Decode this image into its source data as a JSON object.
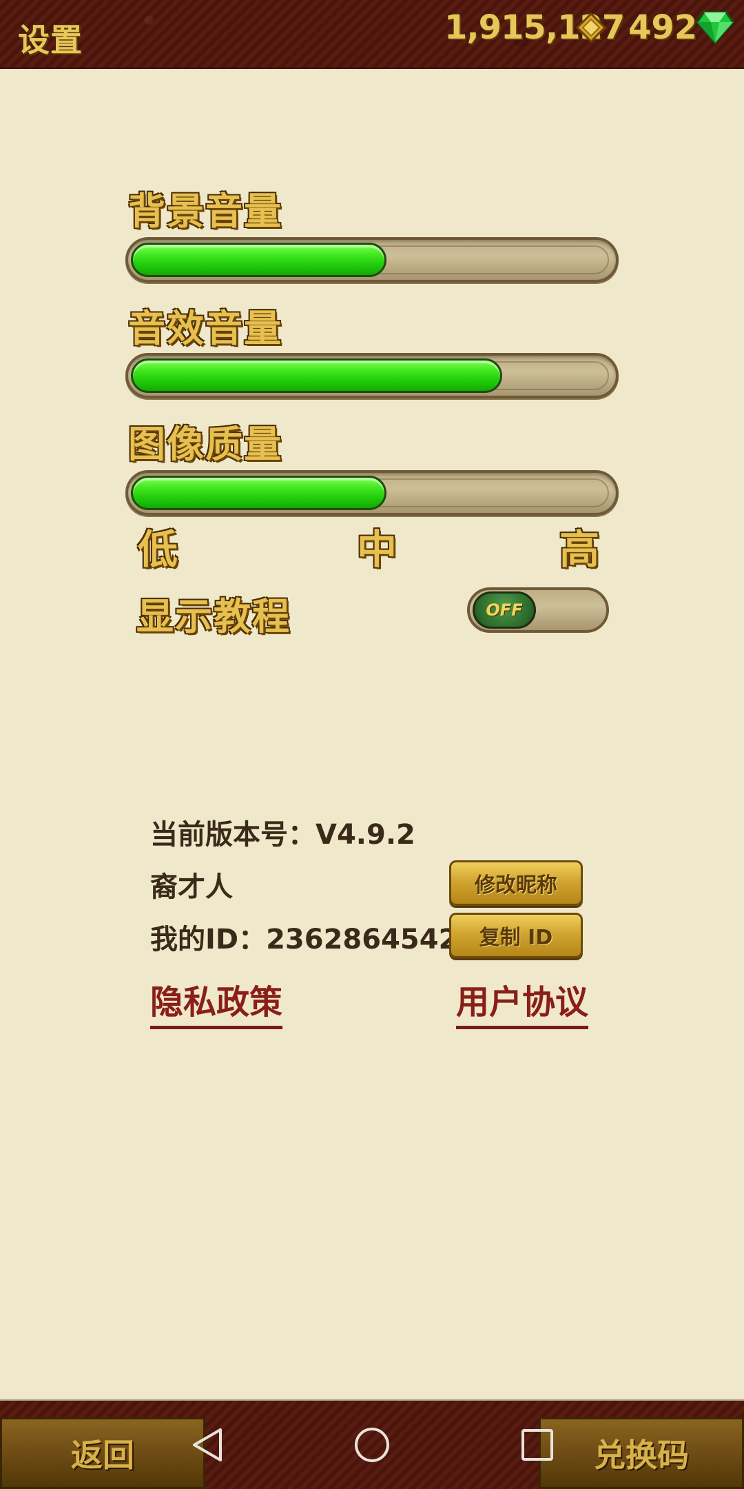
{
  "header": {
    "title": "设置",
    "coins": "1,915,127",
    "gems": "492",
    "coin_icon": "gold-diamond-coin-icon",
    "gem_icon": "green-gem-icon"
  },
  "settings": {
    "bgm_label": "背景音量",
    "bgm_level": 0.53,
    "sfx_label": "音效音量",
    "sfx_level": 0.77,
    "quality_label": "图像质量",
    "quality_level": 0.53,
    "quality_ticks": [
      "低",
      "中",
      "高"
    ],
    "tutorial_label": "显示教程",
    "tutorial_toggle": "OFF"
  },
  "info": {
    "version": "当前版本号：V4.9.2",
    "nickname": "裔才人",
    "rename_button": "修改昵称",
    "user_id": "我的ID：2362864542",
    "copy_id_button": "复制 ID",
    "privacy_link": "隐私政策",
    "agreement_link": "用户协议"
  },
  "footer": {
    "back_button": "返回",
    "redeem_button": "兑换码"
  },
  "colors": {
    "background": "#f0e8cb",
    "header": "#531a0e",
    "gold": "#e6c050",
    "slider_fill": "#2fd612",
    "link": "#8a1e18"
  }
}
